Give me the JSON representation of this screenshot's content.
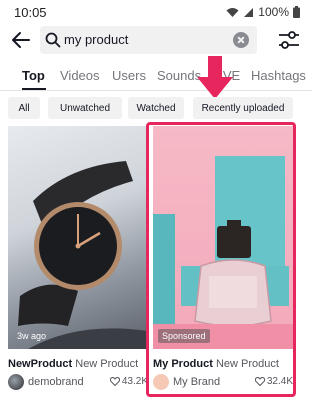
{
  "status_bar": {
    "time": "10:05",
    "battery": "100%"
  },
  "search": {
    "value": "my product"
  },
  "tabs": [
    {
      "label": "Top",
      "active": true
    },
    {
      "label": "Videos"
    },
    {
      "label": "Users"
    },
    {
      "label": "Sounds"
    },
    {
      "label": "LIVE"
    },
    {
      "label": "Hashtags"
    }
  ],
  "filters": [
    "All",
    "Unwatched",
    "Watched",
    "Recently uploaded"
  ],
  "results": [
    {
      "badge": "3w ago",
      "title_bold": "NewProduct",
      "title_rest": " New Product",
      "author": "demobrand",
      "likes": "43.2K"
    },
    {
      "badge": "Sponsored",
      "title_bold": "My Product",
      "title_rest": " New Product",
      "author": "My Brand",
      "likes": "32.4K"
    }
  ],
  "colors": {
    "highlight": "#e8265e",
    "chip_bg": "#f1f1f2",
    "text_primary": "#161823"
  },
  "icons": [
    "back-arrow-icon",
    "search-icon",
    "clear-icon",
    "filter-sliders-icon",
    "heart-icon",
    "wifi-icon",
    "signal-icon",
    "battery-icon"
  ]
}
